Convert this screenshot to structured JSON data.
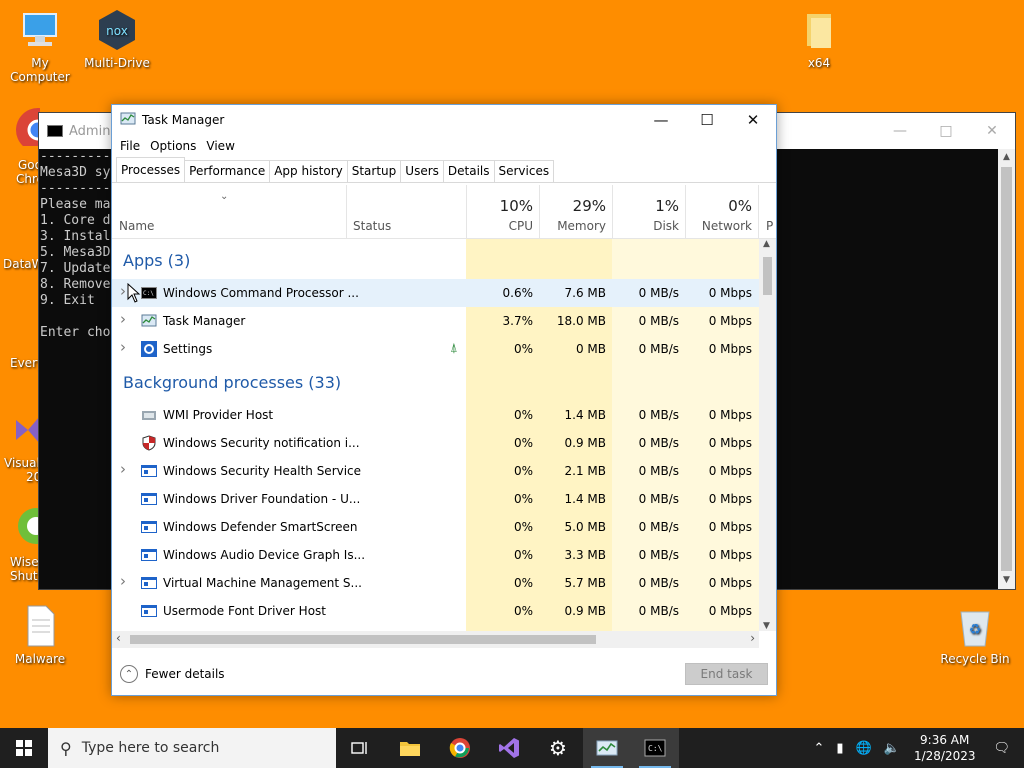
{
  "desktop": {
    "icons": [
      {
        "label": "My Computer"
      },
      {
        "label": "Multi-Drive"
      },
      {
        "label": "x64"
      },
      {
        "label": "Malware"
      },
      {
        "label": "Recycle Bin"
      }
    ],
    "partial_labels": [
      "Goo",
      "Chro",
      "DataW",
      "Every",
      "Visual",
      "20",
      "Wise",
      "Shutd"
    ]
  },
  "cmd": {
    "title": "Adminis",
    "lines": [
      "---------",
      "Mesa3D sy",
      "---------",
      "Please ma",
      "1. Core d",
      "3. Instal",
      "5. Mesa3D",
      "7. Update",
      "8. Remove",
      "9. Exit",
      "",
      "Enter cho"
    ]
  },
  "taskmgr": {
    "title": "Task Manager",
    "menu": [
      "File",
      "Options",
      "View"
    ],
    "tabs": [
      "Processes",
      "Performance",
      "App history",
      "Startup",
      "Users",
      "Details",
      "Services"
    ],
    "columns": {
      "name": "Name",
      "status": "Status",
      "cpu": {
        "pct": "10%",
        "label": "CPU"
      },
      "memory": {
        "pct": "29%",
        "label": "Memory"
      },
      "disk": {
        "pct": "1%",
        "label": "Disk"
      },
      "network": {
        "pct": "0%",
        "label": "Network"
      },
      "power_partial": "P"
    },
    "apps_group": "Apps (3)",
    "bg_group": "Background processes (33)",
    "apps": [
      {
        "name": "Windows Command Processor ...",
        "cpu": "0.6%",
        "mem": "7.6 MB",
        "disk": "0 MB/s",
        "net": "0 Mbps",
        "expand": true,
        "icon": "cmd-icon"
      },
      {
        "name": "Task Manager",
        "cpu": "3.7%",
        "mem": "18.0 MB",
        "disk": "0 MB/s",
        "net": "0 Mbps",
        "expand": true,
        "icon": "taskmanager-icon"
      },
      {
        "name": "Settings",
        "cpu": "0%",
        "mem": "0 MB",
        "disk": "0 MB/s",
        "net": "0 Mbps",
        "expand": true,
        "icon": "settings-icon",
        "suspended": true
      }
    ],
    "background": [
      {
        "name": "WMI Provider Host",
        "cpu": "0%",
        "mem": "1.4 MB",
        "disk": "0 MB/s",
        "net": "0 Mbps",
        "expand": false,
        "icon": "wmi-icon"
      },
      {
        "name": "Windows Security notification i...",
        "cpu": "0%",
        "mem": "0.9 MB",
        "disk": "0 MB/s",
        "net": "0 Mbps",
        "expand": false,
        "icon": "shield-icon"
      },
      {
        "name": "Windows Security Health Service",
        "cpu": "0%",
        "mem": "2.1 MB",
        "disk": "0 MB/s",
        "net": "0 Mbps",
        "expand": true,
        "icon": "service-icon"
      },
      {
        "name": "Windows Driver Foundation - U...",
        "cpu": "0%",
        "mem": "1.4 MB",
        "disk": "0 MB/s",
        "net": "0 Mbps",
        "expand": false,
        "icon": "service-icon"
      },
      {
        "name": "Windows Defender SmartScreen",
        "cpu": "0%",
        "mem": "5.0 MB",
        "disk": "0 MB/s",
        "net": "0 Mbps",
        "expand": false,
        "icon": "service-icon"
      },
      {
        "name": "Windows Audio Device Graph Is...",
        "cpu": "0%",
        "mem": "3.3 MB",
        "disk": "0 MB/s",
        "net": "0 Mbps",
        "expand": false,
        "icon": "service-icon"
      },
      {
        "name": "Virtual Machine Management S...",
        "cpu": "0%",
        "mem": "5.7 MB",
        "disk": "0 MB/s",
        "net": "0 Mbps",
        "expand": true,
        "icon": "service-icon"
      },
      {
        "name": "Usermode Font Driver Host",
        "cpu": "0%",
        "mem": "0.9 MB",
        "disk": "0 MB/s",
        "net": "0 Mbps",
        "expand": false,
        "icon": "service-icon"
      }
    ],
    "fewer_details": "Fewer details",
    "end_task": "End task"
  },
  "taskbar": {
    "search_placeholder": "Type here to search",
    "time": "9:36 AM",
    "date": "1/28/2023"
  },
  "colors": {
    "desktop": "#fe8d00",
    "cpu_bg": "#fff4c4",
    "mem_bg": "#fff4c4",
    "light_bg": "#fff9dc",
    "group_text": "#1f5aa8"
  }
}
